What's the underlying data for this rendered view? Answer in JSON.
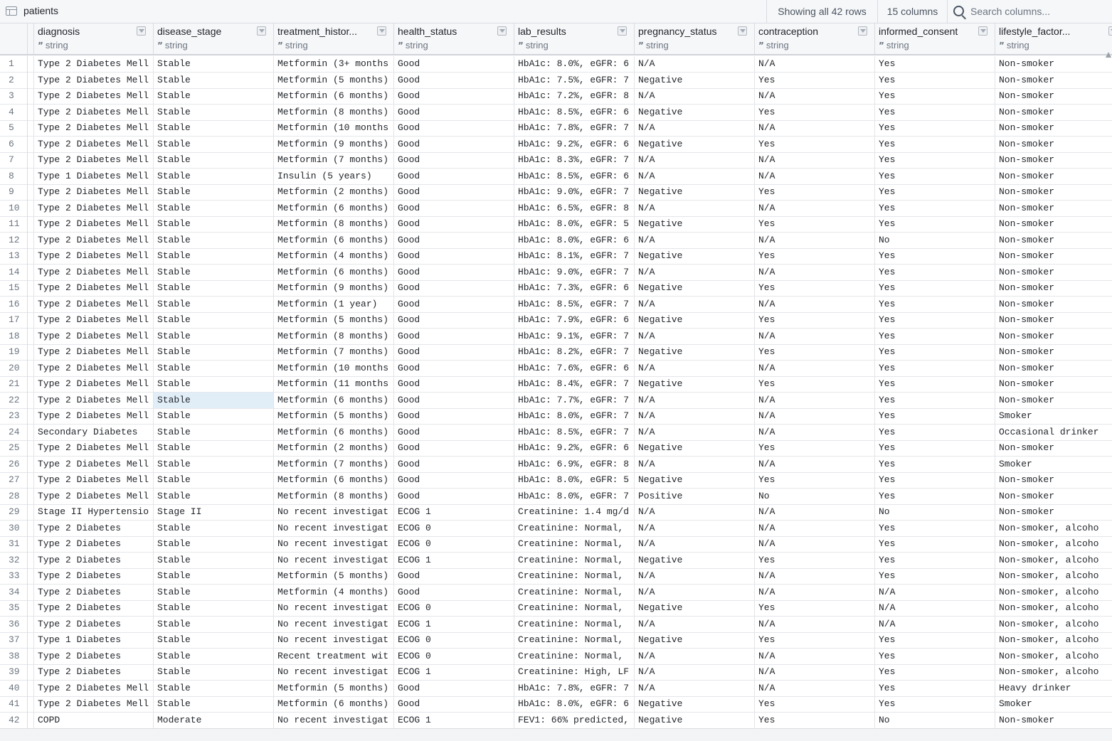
{
  "toolbar": {
    "table_name": "patients",
    "rows_info": "Showing all 42 rows",
    "cols_info": "15 columns",
    "search_placeholder": "Search columns..."
  },
  "columns": [
    {
      "name": "diagnosis",
      "type": "string"
    },
    {
      "name": "disease_stage",
      "type": "string"
    },
    {
      "name": "treatment_histor...",
      "type": "string"
    },
    {
      "name": "health_status",
      "type": "string"
    },
    {
      "name": "lab_results",
      "type": "string"
    },
    {
      "name": "pregnancy_status",
      "type": "string"
    },
    {
      "name": "contraception",
      "type": "string"
    },
    {
      "name": "informed_consent",
      "type": "string"
    },
    {
      "name": "lifestyle_factor...",
      "type": "string"
    }
  ],
  "selected_cell": {
    "row": 22,
    "col": 1
  },
  "rows": [
    [
      "1",
      "Type 2 Diabetes Mell",
      "Stable",
      "Metformin (3+ months",
      "Good",
      "HbA1c: 8.0%, eGFR: 6",
      "N/A",
      "N/A",
      "Yes",
      "Non-smoker"
    ],
    [
      "2",
      "Type 2 Diabetes Mell",
      "Stable",
      "Metformin (5 months)",
      "Good",
      "HbA1c: 7.5%, eGFR: 7",
      "Negative",
      "Yes",
      "Yes",
      "Non-smoker"
    ],
    [
      "3",
      "Type 2 Diabetes Mell",
      "Stable",
      "Metformin (6 months)",
      "Good",
      "HbA1c: 7.2%, eGFR: 8",
      "N/A",
      "N/A",
      "Yes",
      "Non-smoker"
    ],
    [
      "4",
      "Type 2 Diabetes Mell",
      "Stable",
      "Metformin (8 months)",
      "Good",
      "HbA1c: 8.5%, eGFR: 6",
      "Negative",
      "Yes",
      "Yes",
      "Non-smoker"
    ],
    [
      "5",
      "Type 2 Diabetes Mell",
      "Stable",
      "Metformin (10 months",
      "Good",
      "HbA1c: 7.8%, eGFR: 7",
      "N/A",
      "N/A",
      "Yes",
      "Non-smoker"
    ],
    [
      "6",
      "Type 2 Diabetes Mell",
      "Stable",
      "Metformin (9 months)",
      "Good",
      "HbA1c: 9.2%, eGFR: 6",
      "Negative",
      "Yes",
      "Yes",
      "Non-smoker"
    ],
    [
      "7",
      "Type 2 Diabetes Mell",
      "Stable",
      "Metformin (7 months)",
      "Good",
      "HbA1c: 8.3%, eGFR: 7",
      "N/A",
      "N/A",
      "Yes",
      "Non-smoker"
    ],
    [
      "8",
      "Type 1 Diabetes Mell",
      "Stable",
      "Insulin (5 years)",
      "Good",
      "HbA1c: 8.5%, eGFR: 6",
      "N/A",
      "N/A",
      "Yes",
      "Non-smoker"
    ],
    [
      "9",
      "Type 2 Diabetes Mell",
      "Stable",
      "Metformin (2 months)",
      "Good",
      "HbA1c: 9.0%, eGFR: 7",
      "Negative",
      "Yes",
      "Yes",
      "Non-smoker"
    ],
    [
      "10",
      "Type 2 Diabetes Mell",
      "Stable",
      "Metformin (6 months)",
      "Good",
      "HbA1c: 6.5%, eGFR: 8",
      "N/A",
      "N/A",
      "Yes",
      "Non-smoker"
    ],
    [
      "11",
      "Type 2 Diabetes Mell",
      "Stable",
      "Metformin (8 months)",
      "Good",
      "HbA1c: 8.0%, eGFR: 5",
      "Negative",
      "Yes",
      "Yes",
      "Non-smoker"
    ],
    [
      "12",
      "Type 2 Diabetes Mell",
      "Stable",
      "Metformin (6 months)",
      "Good",
      "HbA1c: 8.0%, eGFR: 6",
      "N/A",
      "N/A",
      "No",
      "Non-smoker"
    ],
    [
      "13",
      "Type 2 Diabetes Mell",
      "Stable",
      "Metformin (4 months)",
      "Good",
      "HbA1c: 8.1%, eGFR: 7",
      "Negative",
      "Yes",
      "Yes",
      "Non-smoker"
    ],
    [
      "14",
      "Type 2 Diabetes Mell",
      "Stable",
      "Metformin (6 months)",
      "Good",
      "HbA1c: 9.0%, eGFR: 7",
      "N/A",
      "N/A",
      "Yes",
      "Non-smoker"
    ],
    [
      "15",
      "Type 2 Diabetes Mell",
      "Stable",
      "Metformin (9 months)",
      "Good",
      "HbA1c: 7.3%, eGFR: 6",
      "Negative",
      "Yes",
      "Yes",
      "Non-smoker"
    ],
    [
      "16",
      "Type 2 Diabetes Mell",
      "Stable",
      "Metformin (1 year)",
      "Good",
      "HbA1c: 8.5%, eGFR: 7",
      "N/A",
      "N/A",
      "Yes",
      "Non-smoker"
    ],
    [
      "17",
      "Type 2 Diabetes Mell",
      "Stable",
      "Metformin (5 months)",
      "Good",
      "HbA1c: 7.9%, eGFR: 6",
      "Negative",
      "Yes",
      "Yes",
      "Non-smoker"
    ],
    [
      "18",
      "Type 2 Diabetes Mell",
      "Stable",
      "Metformin (8 months)",
      "Good",
      "HbA1c: 9.1%, eGFR: 7",
      "N/A",
      "N/A",
      "Yes",
      "Non-smoker"
    ],
    [
      "19",
      "Type 2 Diabetes Mell",
      "Stable",
      "Metformin (7 months)",
      "Good",
      "HbA1c: 8.2%, eGFR: 7",
      "Negative",
      "Yes",
      "Yes",
      "Non-smoker"
    ],
    [
      "20",
      "Type 2 Diabetes Mell",
      "Stable",
      "Metformin (10 months",
      "Good",
      "HbA1c: 7.6%, eGFR: 6",
      "N/A",
      "N/A",
      "Yes",
      "Non-smoker"
    ],
    [
      "21",
      "Type 2 Diabetes Mell",
      "Stable",
      "Metformin (11 months",
      "Good",
      "HbA1c: 8.4%, eGFR: 7",
      "Negative",
      "Yes",
      "Yes",
      "Non-smoker"
    ],
    [
      "22",
      "Type 2 Diabetes Mell",
      "Stable",
      "Metformin (6 months)",
      "Good",
      "HbA1c: 7.7%, eGFR: 7",
      "N/A",
      "N/A",
      "Yes",
      "Non-smoker"
    ],
    [
      "23",
      "Type 2 Diabetes Mell",
      "Stable",
      "Metformin (5 months)",
      "Good",
      "HbA1c: 8.0%, eGFR: 7",
      "N/A",
      "N/A",
      "Yes",
      "Smoker"
    ],
    [
      "24",
      "Secondary Diabetes",
      "Stable",
      "Metformin (6 months)",
      "Good",
      "HbA1c: 8.5%, eGFR: 7",
      "N/A",
      "N/A",
      "Yes",
      "Occasional drinker"
    ],
    [
      "25",
      "Type 2 Diabetes Mell",
      "Stable",
      "Metformin (2 months)",
      "Good",
      "HbA1c: 9.2%, eGFR: 6",
      "Negative",
      "Yes",
      "Yes",
      "Non-smoker"
    ],
    [
      "26",
      "Type 2 Diabetes Mell",
      "Stable",
      "Metformin (7 months)",
      "Good",
      "HbA1c: 6.9%, eGFR: 8",
      "N/A",
      "N/A",
      "Yes",
      "Smoker"
    ],
    [
      "27",
      "Type 2 Diabetes Mell",
      "Stable",
      "Metformin (6 months)",
      "Good",
      "HbA1c: 8.0%, eGFR: 5",
      "Negative",
      "Yes",
      "Yes",
      "Non-smoker"
    ],
    [
      "28",
      "Type 2 Diabetes Mell",
      "Stable",
      "Metformin (8 months)",
      "Good",
      "HbA1c: 8.0%, eGFR: 7",
      "Positive",
      "No",
      "Yes",
      "Non-smoker"
    ],
    [
      "29",
      "Stage II Hypertensio",
      "Stage II",
      "No recent investigat",
      "ECOG 1",
      "Creatinine: 1.4 mg/d",
      "N/A",
      "N/A",
      "No",
      "Non-smoker"
    ],
    [
      "30",
      "Type 2 Diabetes",
      "Stable",
      "No recent investigat",
      "ECOG 0",
      "Creatinine: Normal,",
      "N/A",
      "N/A",
      "Yes",
      "Non-smoker, alcoho"
    ],
    [
      "31",
      "Type 2 Diabetes",
      "Stable",
      "No recent investigat",
      "ECOG 0",
      "Creatinine: Normal,",
      "N/A",
      "N/A",
      "Yes",
      "Non-smoker, alcoho"
    ],
    [
      "32",
      "Type 2 Diabetes",
      "Stable",
      "No recent investigat",
      "ECOG 1",
      "Creatinine: Normal,",
      "Negative",
      "Yes",
      "Yes",
      "Non-smoker, alcoho"
    ],
    [
      "33",
      "Type 2 Diabetes",
      "Stable",
      "Metformin (5 months)",
      "Good",
      "Creatinine: Normal,",
      "N/A",
      "N/A",
      "Yes",
      "Non-smoker, alcoho"
    ],
    [
      "34",
      "Type 2 Diabetes",
      "Stable",
      "Metformin (4 months)",
      "Good",
      "Creatinine: Normal,",
      "N/A",
      "N/A",
      "N/A",
      "Non-smoker, alcoho"
    ],
    [
      "35",
      "Type 2 Diabetes",
      "Stable",
      "No recent investigat",
      "ECOG 0",
      "Creatinine: Normal,",
      "Negative",
      "Yes",
      "N/A",
      "Non-smoker, alcoho"
    ],
    [
      "36",
      "Type 2 Diabetes",
      "Stable",
      "No recent investigat",
      "ECOG 1",
      "Creatinine: Normal,",
      "N/A",
      "N/A",
      "N/A",
      "Non-smoker, alcoho"
    ],
    [
      "37",
      "Type 1 Diabetes",
      "Stable",
      "No recent investigat",
      "ECOG 0",
      "Creatinine: Normal,",
      "Negative",
      "Yes",
      "Yes",
      "Non-smoker, alcoho"
    ],
    [
      "38",
      "Type 2 Diabetes",
      "Stable",
      "Recent treatment wit",
      "ECOG 0",
      "Creatinine: Normal,",
      "N/A",
      "N/A",
      "Yes",
      "Non-smoker, alcoho"
    ],
    [
      "39",
      "Type 2 Diabetes",
      "Stable",
      "No recent investigat",
      "ECOG 1",
      "Creatinine: High, LF",
      "N/A",
      "N/A",
      "Yes",
      "Non-smoker, alcoho"
    ],
    [
      "40",
      "Type 2 Diabetes Mell",
      "Stable",
      "Metformin (5 months)",
      "Good",
      "HbA1c: 7.8%, eGFR: 7",
      "N/A",
      "N/A",
      "Yes",
      "Heavy drinker"
    ],
    [
      "41",
      "Type 2 Diabetes Mell",
      "Stable",
      "Metformin (6 months)",
      "Good",
      "HbA1c: 8.0%, eGFR: 6",
      "Negative",
      "Yes",
      "Yes",
      "Smoker"
    ],
    [
      "42",
      "COPD",
      "Moderate",
      "No recent investigat",
      "ECOG 1",
      "FEV1: 66% predicted,",
      "Negative",
      "Yes",
      "No",
      "Non-smoker"
    ]
  ]
}
